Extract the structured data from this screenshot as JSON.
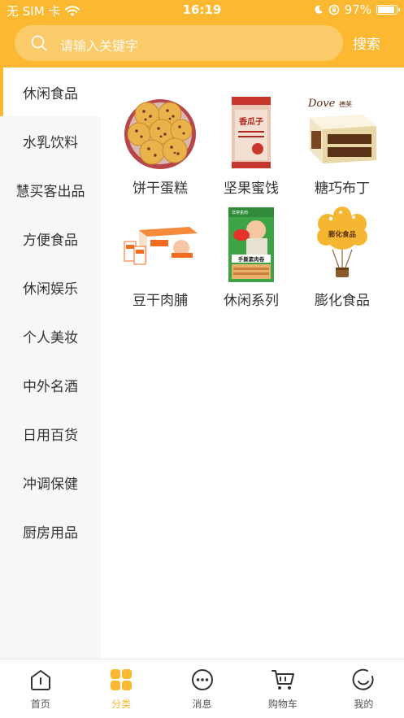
{
  "status_bar": {
    "carrier": "无 SIM 卡",
    "time": "16:19",
    "battery_percent": "97%",
    "battery_level": 0.97
  },
  "search": {
    "placeholder": "请输入关键字",
    "button_label": "搜索"
  },
  "sidebar": {
    "active_index": 0,
    "items": [
      {
        "label": "休闲食品"
      },
      {
        "label": "水乳饮料"
      },
      {
        "label": "慧买客出品"
      },
      {
        "label": "方便食品"
      },
      {
        "label": "休闲娱乐"
      },
      {
        "label": "个人美妆"
      },
      {
        "label": "中外名酒"
      },
      {
        "label": "日用百货"
      },
      {
        "label": "冲调保健"
      },
      {
        "label": "厨房用品"
      }
    ]
  },
  "products": {
    "items": [
      {
        "label": "饼干蛋糕",
        "image": "cookie-plate"
      },
      {
        "label": "坚果蜜饯",
        "image": "seed-bag"
      },
      {
        "label": "糖巧布丁",
        "image": "chocolate-box"
      },
      {
        "label": "豆干肉脯",
        "image": "snack-box"
      },
      {
        "label": "休闲系列",
        "image": "snack-pack"
      },
      {
        "label": "膨化食品",
        "image": "puffed-balloon"
      }
    ],
    "brand_texts": {
      "seed_bag": "香瓜子",
      "chocolate_brand": "Dove",
      "chocolate_sub": "德芙",
      "snack_pack_title": "手撕素肉卷",
      "snack_pack_brand": "非常素肉",
      "puffed_text": "膨化食品"
    }
  },
  "tabbar": {
    "active_index": 1,
    "tabs": [
      {
        "label": "首页",
        "icon": "home-icon"
      },
      {
        "label": "分类",
        "icon": "category-icon"
      },
      {
        "label": "消息",
        "icon": "message-icon"
      },
      {
        "label": "购物车",
        "icon": "cart-icon"
      },
      {
        "label": "我的",
        "icon": "profile-icon"
      }
    ]
  },
  "colors": {
    "accent": "#fbb830",
    "sidebar_bg": "#f7f7f7",
    "text": "#333333"
  }
}
